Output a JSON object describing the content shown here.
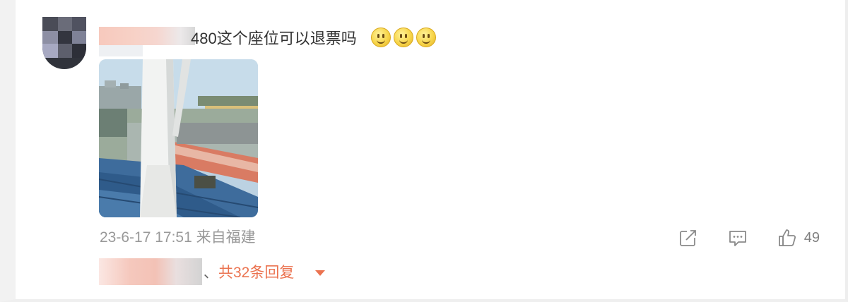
{
  "comment": {
    "text": "480这个座位可以退票吗",
    "emojis": [
      "smile-emoji",
      "smile-emoji",
      "smile-emoji"
    ],
    "image_alt": "stadium seating photo"
  },
  "meta": {
    "timestamp": "23-6-17 17:51",
    "location": "来自福建"
  },
  "actions": {
    "share_icon": "share-icon",
    "comment_icon": "comment-icon",
    "like_icon": "thumbs-up-icon",
    "like_count": "49"
  },
  "replies": {
    "separator": "、",
    "label": "共32条回复",
    "caret_icon": "caret-down-icon"
  },
  "colors": {
    "text": "#333333",
    "meta": "#999999",
    "accent": "#eb7350"
  }
}
